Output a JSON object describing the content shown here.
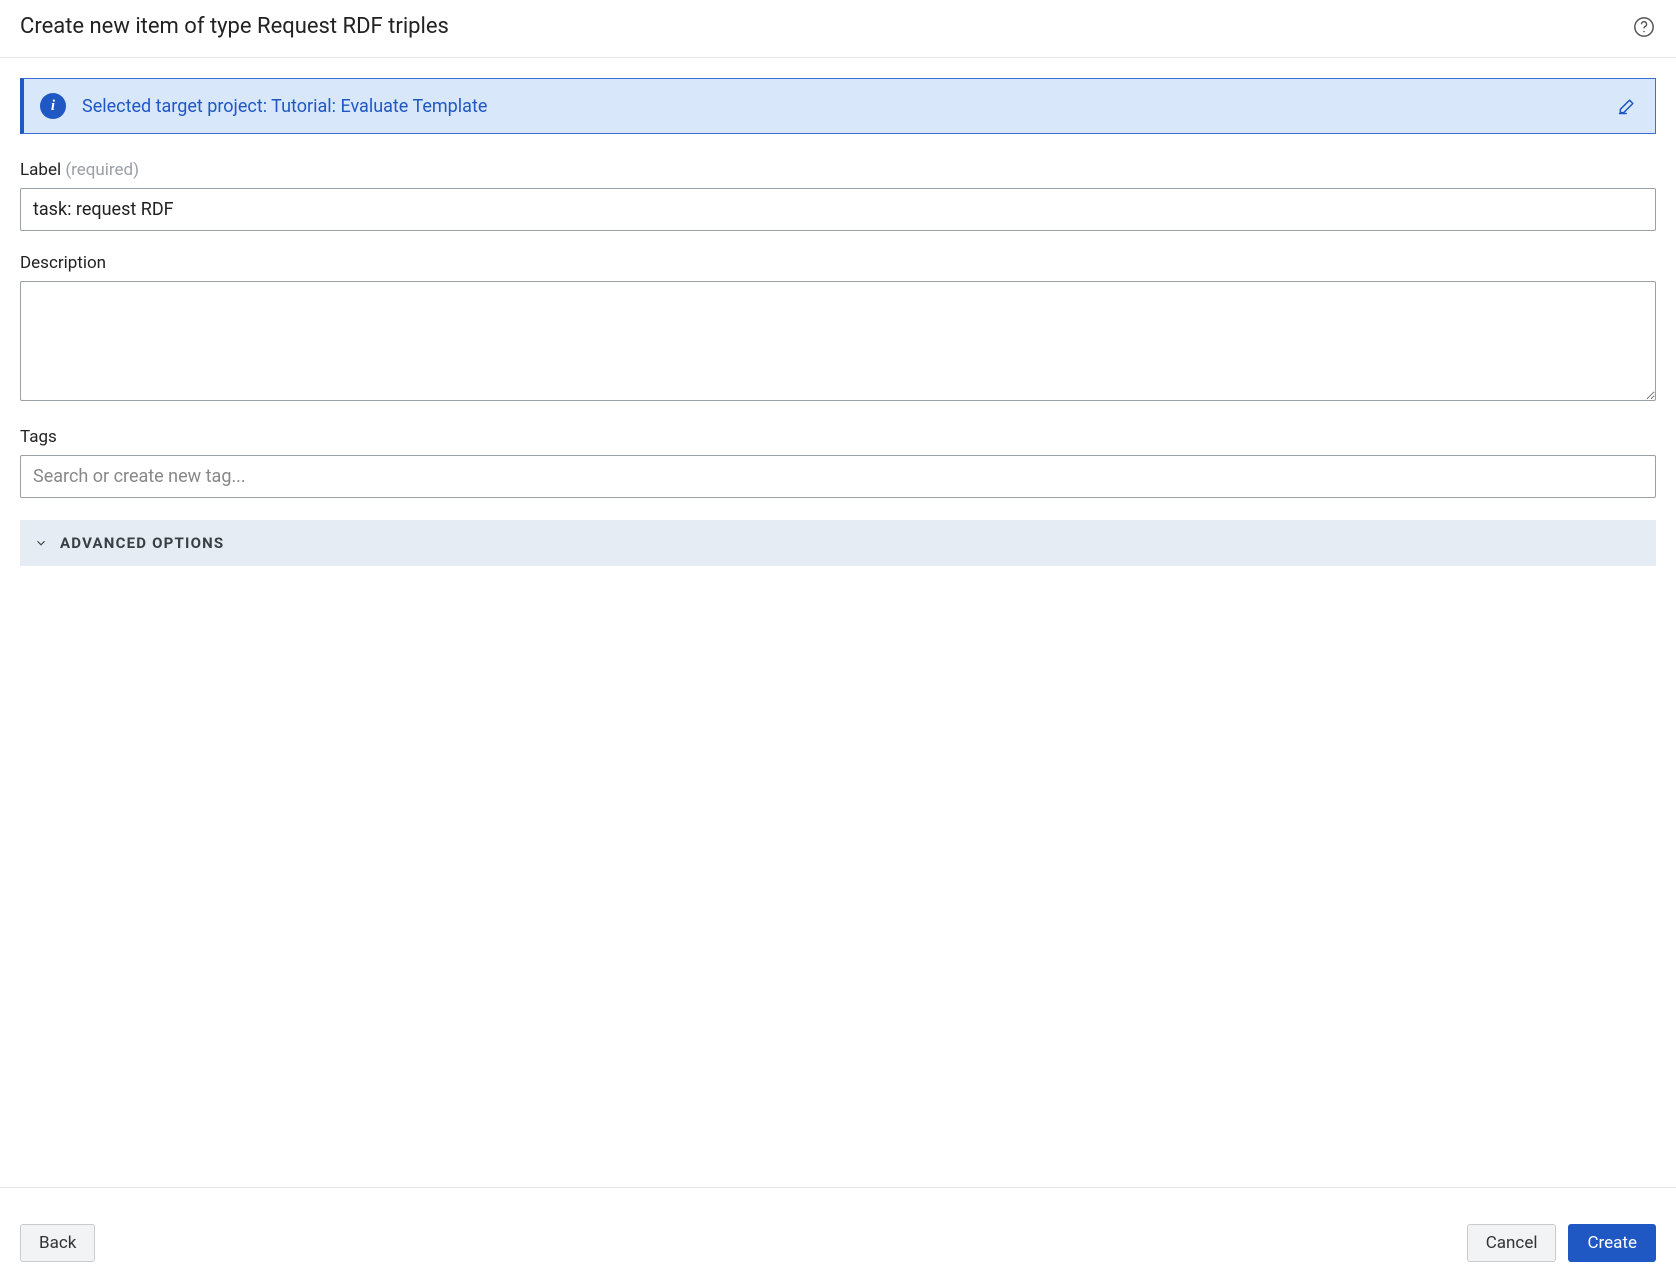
{
  "header": {
    "title": "Create new item of type Request RDF triples"
  },
  "banner": {
    "text": "Selected target project: Tutorial: Evaluate Template"
  },
  "form": {
    "label_field": {
      "label": "Label",
      "required_hint": "(required)",
      "value": "task: request RDF"
    },
    "description_field": {
      "label": "Description",
      "value": ""
    },
    "tags_field": {
      "label": "Tags",
      "placeholder": "Search or create new tag...",
      "value": ""
    },
    "advanced": {
      "label": "Advanced Options"
    }
  },
  "footer": {
    "back": "Back",
    "cancel": "Cancel",
    "create": "Create"
  }
}
